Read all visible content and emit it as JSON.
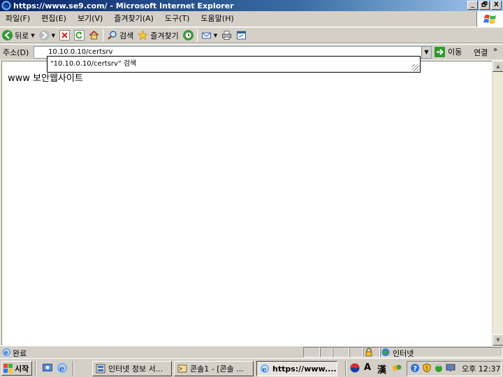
{
  "window": {
    "title": "https://www.se9.com/ - Microsoft Internet Explorer",
    "controls": [
      "_",
      "🗗",
      "X"
    ]
  },
  "menubar": {
    "items": [
      "파일(F)",
      "편집(E)",
      "보기(V)",
      "즐겨찾기(A)",
      "도구(T)",
      "도움말(H)"
    ]
  },
  "toolbar": {
    "back_label": "뒤로",
    "search_label": "검색",
    "favorites_label": "즐겨찾기"
  },
  "address": {
    "label": "주소(D)",
    "value": "10.10.0.10/certsrv",
    "go_label": "이동",
    "links_label": "연결"
  },
  "autocomplete": {
    "suggestion": "\"10.10.0.10/certsrv\" 검색"
  },
  "content": {
    "text": "www 보안웹사이트"
  },
  "statusbar": {
    "status": "완료",
    "zone": "인터넷"
  },
  "taskbar": {
    "start_label": "시작",
    "tasks": [
      "인터넷 정보 서...",
      "콘솔1 - [콘솔 ...",
      "https://www...."
    ],
    "ime_letters": [
      "A",
      "漢"
    ],
    "clock": "오후 12:37"
  },
  "colors": {
    "titlebar": "#0a246a",
    "chrome": "#d4d0c8",
    "go_green": "#2e9a2e"
  }
}
